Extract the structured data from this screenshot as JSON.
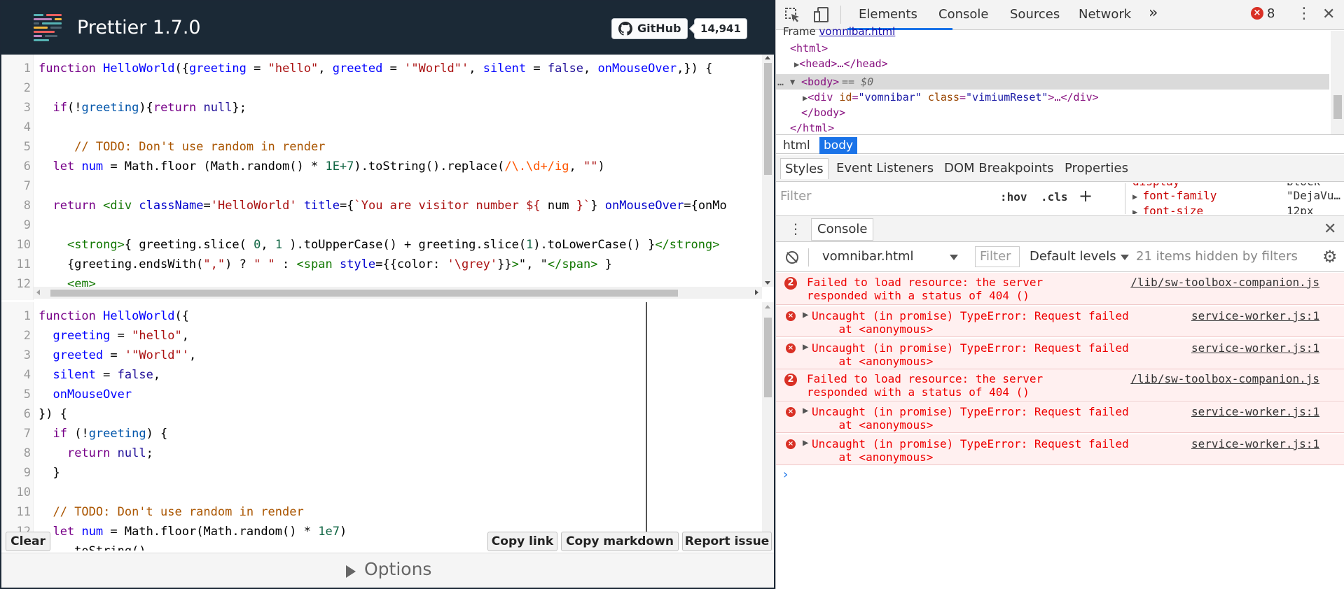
{
  "playground": {
    "title": "Prettier 1.7.0",
    "github_label": "GitHub",
    "github_count": "14,941",
    "input_lines": [
      {
        "n": "1",
        "html": "<span class=\"kw\">function</span> <span class=\"def\">HelloWorld</span>({<span class=\"def\">greeting</span> = <span class=\"str\">\"hello\"</span>, <span class=\"def\">greeted</span> = <span class=\"str\">'\"World\"'</span>, <span class=\"def\">silent</span> = <span class=\"atom\">false</span>, <span class=\"def\">onMouseOver</span>,}) {"
      },
      {
        "n": "2",
        "html": ""
      },
      {
        "n": "3",
        "html": "  <span class=\"kw\">if</span>(!<span class=\"var2\">greeting</span>){<span class=\"kw\">return</span> <span class=\"atom\">null</span>};"
      },
      {
        "n": "4",
        "html": ""
      },
      {
        "n": "5",
        "html": "     <span class=\"com\">// TODO: Don't use random in render</span>"
      },
      {
        "n": "6",
        "html": "  <span class=\"kw\">let</span> <span class=\"def\">num</span> = Math.floor (Math.random() * <span class=\"num\">1E+7</span>).toString().replace(<span class=\"re\">/\\.\\d+/ig</span>, <span class=\"str\">\"\"</span>)"
      },
      {
        "n": "7",
        "html": ""
      },
      {
        "n": "8",
        "html": "  <span class=\"kw\">return</span> <span class=\"tag\">&lt;div</span> <span class=\"attr\">className</span>=<span class=\"str\">'HelloWorld'</span> <span class=\"attr\">title</span>={<span class=\"tmpl\">`You are visitor number ${</span> num <span class=\"tmpl\">}`</span>} <span class=\"attr\">onMouseOver</span>={onMo"
      },
      {
        "n": "9",
        "html": ""
      },
      {
        "n": "10",
        "html": "    <span class=\"tag\">&lt;strong&gt;</span>{ greeting.slice( <span class=\"num\">0</span>, <span class=\"num\">1</span> ).toUpperCase() + greeting.slice(<span class=\"num\">1</span>).toLowerCase() }<span class=\"tag\">&lt;/strong&gt;</span>"
      },
      {
        "n": "11",
        "html": "    {greeting.endsWith(<span class=\"str\">\",\"</span>) ? <span class=\"str\">\" \"</span> : <span class=\"tag\">&lt;span</span> <span class=\"attr\">style</span>={{color: <span class=\"str\">'\\grey'</span>}}<span class=\"tag\">&gt;</span>\", \"<span class=\"tag\">&lt;/span&gt;</span> }"
      },
      {
        "n": "12",
        "html": "    <span class=\"tag\">&lt;em&gt;</span>"
      }
    ],
    "output_lines": [
      {
        "n": "1",
        "html": "<span class=\"kw\">function</span> <span class=\"def\">HelloWorld</span>({"
      },
      {
        "n": "2",
        "html": "  <span class=\"def\">greeting</span> = <span class=\"str\">\"hello\"</span>,"
      },
      {
        "n": "3",
        "html": "  <span class=\"def\">greeted</span> = <span class=\"str\">'\"World\"'</span>,"
      },
      {
        "n": "4",
        "html": "  <span class=\"def\">silent</span> = <span class=\"atom\">false</span>,"
      },
      {
        "n": "5",
        "html": "  <span class=\"def\">onMouseOver</span>"
      },
      {
        "n": "6",
        "html": "}) {"
      },
      {
        "n": "7",
        "html": "  <span class=\"kw\">if</span> (!<span class=\"var2\">greeting</span>) {"
      },
      {
        "n": "8",
        "html": "    <span class=\"kw\">return</span> <span class=\"atom\">null</span>;"
      },
      {
        "n": "9",
        "html": "  }"
      },
      {
        "n": "10",
        "html": ""
      },
      {
        "n": "11",
        "html": "  <span class=\"com\">// TODO: Don't use random in render</span>"
      },
      {
        "n": "12",
        "html": "  <span class=\"kw\">let</span> <span class=\"def\">num</span> = Math.floor(Math.random() * <span class=\"num\">1e7</span>)"
      },
      {
        "n": "13",
        "html": "    .toString()"
      }
    ],
    "buttons": {
      "clear": "Clear",
      "copy_link": "Copy link",
      "copy_markdown": "Copy markdown",
      "report_issue": "Report issue"
    },
    "options_label": "Options"
  },
  "devtools": {
    "tabs": [
      "Elements",
      "Console",
      "Sources",
      "Network"
    ],
    "more_tabs": "»",
    "error_count": "8",
    "frame_label": "Frame",
    "frame_link": "vomnibar.html",
    "tree": {
      "html_open": "<html>",
      "head": "<head>…</head>",
      "body": "<body>",
      "body_suffix": "== $0",
      "div_tag_open": "<div",
      "div_id_attr": "id",
      "div_id_val": "\"vomnibar\"",
      "div_class_attr": "class",
      "div_class_val": "\"vimiumReset\"",
      "div_tag_close": ">…</div>",
      "body_close": "</body>",
      "html_close": "</html>"
    },
    "breadcrumbs": [
      "html",
      "body"
    ],
    "styles_tabs": [
      "Styles",
      "Event Listeners",
      "DOM Breakpoints",
      "Properties"
    ],
    "styles_filter_placeholder": "Filter",
    "hov": ":hov",
    "cls": ".cls",
    "plus": "+",
    "computed": [
      {
        "name": "display",
        "value": "block"
      },
      {
        "name": "font-family",
        "value": "\"DejaVu…"
      },
      {
        "name": "font-size",
        "value": "12px"
      }
    ],
    "drawer_tab": "Console",
    "console": {
      "context": "vomnibar.html",
      "filter_placeholder": "Filter",
      "levels": "Default levels",
      "hidden": "21 items hidden by filters",
      "messages": [
        {
          "count": "2",
          "line1": "Failed to load resource: the server",
          "line2": "responded with a status of 404 ()",
          "src": "/lib/sw-toolbox-companion.js",
          "caret": false
        },
        {
          "count": "×",
          "line1": "Uncaught (in promise) TypeError: Request failed",
          "line2": "  at <anonymous>",
          "src": "service-worker.js:1",
          "caret": true
        },
        {
          "count": "×",
          "line1": "Uncaught (in promise) TypeError: Request failed",
          "line2": "  at <anonymous>",
          "src": "service-worker.js:1",
          "caret": true
        },
        {
          "count": "2",
          "line1": "Failed to load resource: the server",
          "line2": "responded with a status of 404 ()",
          "src": "/lib/sw-toolbox-companion.js",
          "caret": false
        },
        {
          "count": "×",
          "line1": "Uncaught (in promise) TypeError: Request failed",
          "line2": "  at <anonymous>",
          "src": "service-worker.js:1",
          "caret": true
        },
        {
          "count": "×",
          "line1": "Uncaught (in promise) TypeError: Request failed",
          "line2": "  at <anonymous>",
          "src": "service-worker.js:1",
          "caret": true
        }
      ],
      "prompt": "›"
    }
  }
}
